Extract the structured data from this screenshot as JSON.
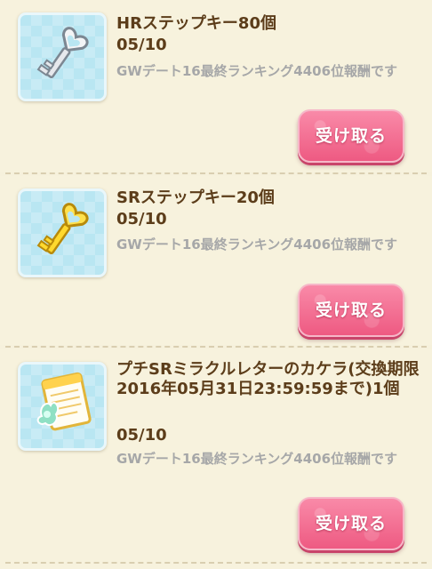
{
  "rewards": [
    {
      "title": "HRステップキー80個",
      "date": "05/10",
      "description": "GWデート16最終ランキング4406位報酬です",
      "icon": "silver-heart-key-icon",
      "button_label": "受け取る"
    },
    {
      "title": "SRステップキー20個",
      "date": "05/10",
      "description": "GWデート16最終ランキング4406位報酬です",
      "icon": "gold-heart-key-icon",
      "button_label": "受け取る"
    },
    {
      "title": "プチSRミラクルレターのカケラ(交換期限2016年05月31日23:59:59まで)1個",
      "date": "05/10",
      "description": "GWデート16最終ランキング4406位報酬です",
      "icon": "letter-fragment-icon",
      "button_label": "受け取る"
    }
  ],
  "colors": {
    "background": "#f6f1dc",
    "title_text": "#5c3d1a",
    "description_text": "#a6a7a8",
    "button": "#ee5a82",
    "thumbnail": "#b9e6f2"
  }
}
